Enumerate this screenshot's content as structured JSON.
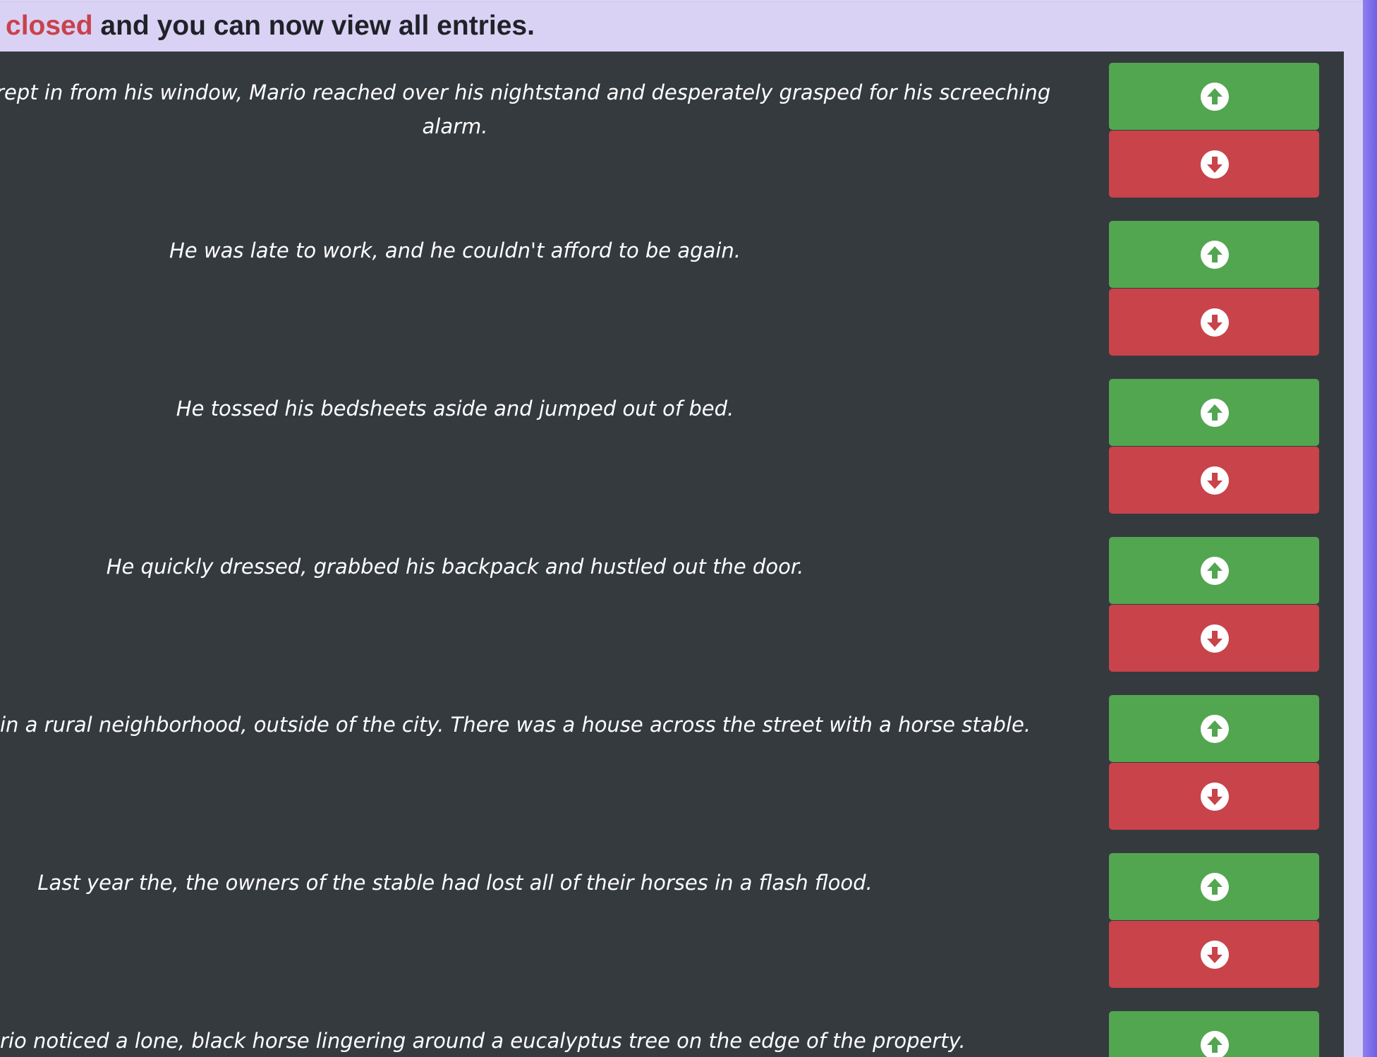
{
  "banner": {
    "highlight": "closed",
    "rest": " and you can now view all entries."
  },
  "colors": {
    "banner_background": "#d9d2f4",
    "highlight": "#c8424c",
    "content_background": "#353a3f",
    "upvote": "#52a650",
    "downvote": "#c9434a",
    "edge": "#7f6fe6"
  },
  "icons": {
    "upvote": "arrow-circle-up-icon",
    "downvote": "arrow-circle-down-icon"
  },
  "entries": [
    {
      "text": "morning air crept in from his window, Mario reached over his nightstand and desperately grasped for his screeching alarm."
    },
    {
      "text": "He was late to work, and he couldn't afford to be again."
    },
    {
      "text": "He tossed his bedsheets aside and jumped out of bed."
    },
    {
      "text": "He quickly dressed, grabbed his backpack and hustled out the door."
    },
    {
      "text": "in a rural neighborhood, outside of the city. There was a house across the street with a horse stable."
    },
    {
      "text": "Last year the, the owners of the stable had lost all of their horses in a flash flood."
    },
    {
      "text": "rio noticed a lone, black horse lingering around a eucalyptus tree on the edge of the property."
    }
  ]
}
